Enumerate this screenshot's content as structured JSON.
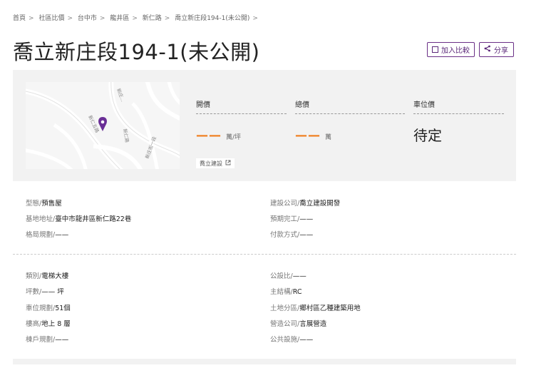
{
  "breadcrumb": [
    "首頁",
    "社區比價",
    "台中市",
    "龍井區",
    "新仁路",
    "喬立新庄段194-1(未公開)"
  ],
  "breadcrumb_sep": ">",
  "title": "喬立新庄段194-1(未公開)",
  "actions": {
    "compare": "加入比較",
    "share": "分享"
  },
  "map": {
    "roads": [
      "新庄...",
      "新仁五路",
      "新仁路",
      "新庄街一段"
    ]
  },
  "prices": {
    "open": {
      "label": "開價",
      "value": "——",
      "unit": "萬/坪"
    },
    "total": {
      "label": "總價",
      "value": "——",
      "unit": "萬"
    },
    "parking": {
      "label": "車位價",
      "value": "待定"
    }
  },
  "developer_tag": "喬立建設",
  "details_top": [
    {
      "label": "型態/",
      "value": "預售屋"
    },
    {
      "label": "基地地址/",
      "value": "臺中市龍井區新仁路22巷"
    },
    {
      "label": "格局規劃/",
      "value": "——"
    },
    {
      "label": "建設公司/",
      "value": "喬立建設開發"
    },
    {
      "label": "預期完工/",
      "value": "——"
    },
    {
      "label": "付款方式/",
      "value": "——"
    }
  ],
  "details_bottom": [
    {
      "label": "類別/",
      "value": "電梯大樓"
    },
    {
      "label": "坪數/",
      "value": "—— 坪"
    },
    {
      "label": "車位規劃/",
      "value": "51個"
    },
    {
      "label": "樓高/",
      "value": "地上 8 層"
    },
    {
      "label": "棟戶規劃/",
      "value": "——"
    },
    {
      "label": "公設比/",
      "value": "——"
    },
    {
      "label": "主結構/",
      "value": "RC"
    },
    {
      "label": "土地分區/",
      "value": "鄉村區乙種建築用地"
    },
    {
      "label": "營造公司/",
      "value": "言展營造"
    },
    {
      "label": "公共設施/",
      "value": "——"
    }
  ],
  "colors": {
    "accent": "#5b2779",
    "dash": "#f07c1a",
    "pin": "#6a2f96"
  }
}
